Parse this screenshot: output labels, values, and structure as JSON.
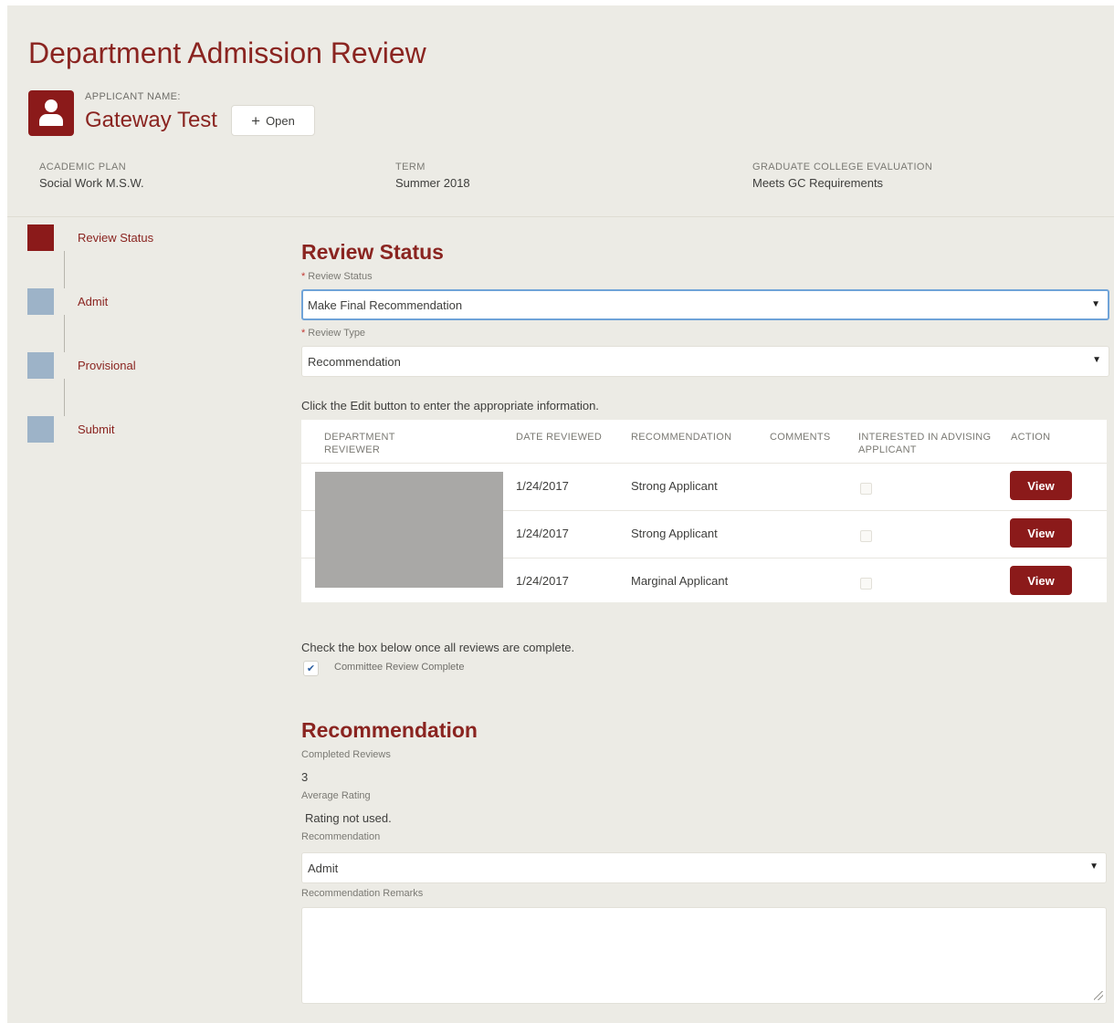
{
  "header": {
    "title": "Department Admission Review",
    "applicant_label": "APPLICANT NAME:",
    "applicant_name": "Gateway Test",
    "open_button": "Open",
    "fields": [
      {
        "label": "ACADEMIC PLAN",
        "value": "Social Work M.S.W."
      },
      {
        "label": "TERM",
        "value": "Summer 2018"
      },
      {
        "label": "GRADUATE COLLEGE EVALUATION",
        "value": "Meets GC Requirements"
      }
    ]
  },
  "steps": [
    {
      "label": "Review Status",
      "active": true
    },
    {
      "label": "Admit",
      "active": false
    },
    {
      "label": "Provisional",
      "active": false
    },
    {
      "label": "Submit",
      "active": false
    }
  ],
  "review_status": {
    "title": "Review Status",
    "status_label": "Review Status",
    "status_value": "Make Final Recommendation",
    "type_label": "Review Type",
    "type_value": "Recommendation",
    "instruction": "Click the Edit button to enter the appropriate information."
  },
  "table": {
    "headers": {
      "reviewer": "DEPARTMENT REVIEWER",
      "date": "DATE REVIEWED",
      "recommendation": "RECOMMENDATION",
      "comments": "COMMENTS",
      "interested": "INTERESTED IN ADVISING APPLICANT",
      "action": "ACTION"
    },
    "rows": [
      {
        "date": "1/24/2017",
        "recommendation": "Strong Applicant",
        "action": "View"
      },
      {
        "date": "1/24/2017",
        "recommendation": "Strong Applicant",
        "action": "View"
      },
      {
        "date": "1/24/2017",
        "recommendation": "Marginal Applicant",
        "action": "View"
      }
    ]
  },
  "completion": {
    "instruction": "Check the box below once all reviews are complete.",
    "checkbox_label": "Committee Review Complete",
    "checked": true
  },
  "recommendation": {
    "title": "Recommendation",
    "completed_label": "Completed Reviews",
    "completed_value": "3",
    "avg_label": "Average Rating",
    "avg_value": "Rating not used.",
    "rec_label": "Recommendation",
    "rec_value": "Admit",
    "remarks_label": "Recommendation Remarks",
    "remarks_value": ""
  },
  "colors": {
    "accent": "#8b1a1a",
    "step_inactive": "#9db3c8",
    "background": "#ecebe5"
  },
  "icons": {
    "avatar": "user-icon",
    "open": "plus-icon",
    "select": "caret-down-icon",
    "check": "checkmark-icon"
  }
}
